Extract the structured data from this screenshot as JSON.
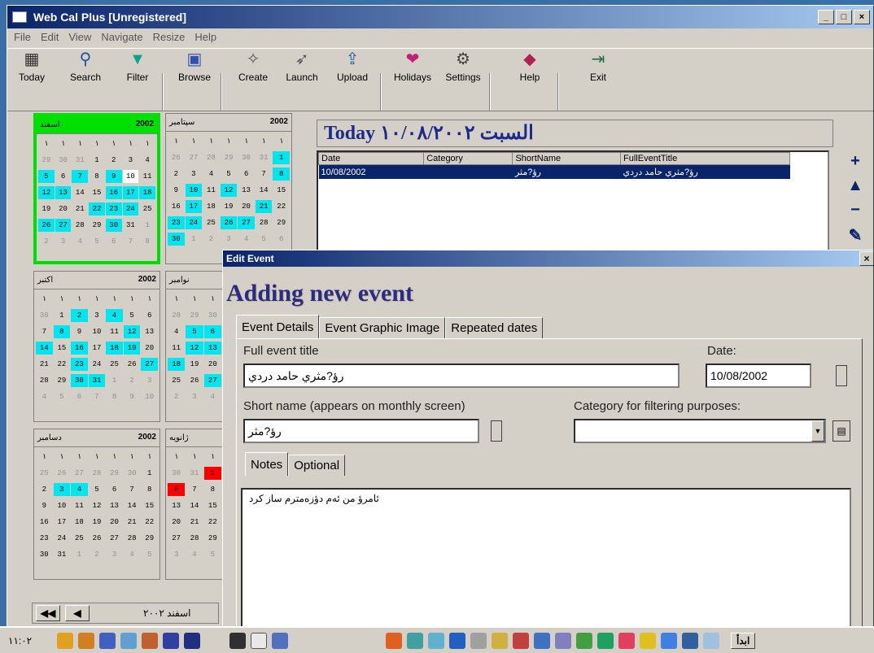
{
  "app": {
    "title": "Web Cal Plus [Unregistered]"
  },
  "window_controls": {
    "min": "_",
    "max": "□",
    "close": "×"
  },
  "menu": [
    "File",
    "Edit",
    "View",
    "Navigate",
    "Resize",
    "Help"
  ],
  "toolbar": {
    "today": "Today",
    "search": "Search",
    "filter": "Filter",
    "browse": "Browse",
    "create": "Create",
    "launch": "Launch",
    "upload": "Upload",
    "holidays": "Holidays",
    "settings": "Settings",
    "help": "Help",
    "exit": "Exit"
  },
  "calendars": [
    {
      "month": "اسفند",
      "year": "2002",
      "days": [
        {
          "t": "١"
        },
        {
          "t": "١"
        },
        {
          "t": "١"
        },
        {
          "t": "١"
        },
        {
          "t": "١"
        },
        {
          "t": "١"
        },
        {
          "t": "١"
        },
        {
          "t": "29",
          "s": "g"
        },
        {
          "t": "30",
          "s": "g"
        },
        {
          "t": "31",
          "s": "g"
        },
        {
          "t": "1"
        },
        {
          "t": "2"
        },
        {
          "t": "3"
        },
        {
          "t": "4"
        },
        {
          "t": "5",
          "s": "c"
        },
        {
          "t": "6"
        },
        {
          "t": "7",
          "s": "c"
        },
        {
          "t": "8"
        },
        {
          "t": "9",
          "s": "c"
        },
        {
          "t": "10",
          "s": "w"
        },
        {
          "t": "11"
        },
        {
          "t": "12",
          "s": "c"
        },
        {
          "t": "13",
          "s": "c"
        },
        {
          "t": "14"
        },
        {
          "t": "15"
        },
        {
          "t": "16",
          "s": "c"
        },
        {
          "t": "17",
          "s": "c"
        },
        {
          "t": "18",
          "s": "c"
        },
        {
          "t": "19"
        },
        {
          "t": "20"
        },
        {
          "t": "21"
        },
        {
          "t": "22",
          "s": "c"
        },
        {
          "t": "23",
          "s": "c"
        },
        {
          "t": "24",
          "s": "c"
        },
        {
          "t": "25"
        },
        {
          "t": "26",
          "s": "c"
        },
        {
          "t": "27",
          "s": "c"
        },
        {
          "t": "28"
        },
        {
          "t": "29"
        },
        {
          "t": "30",
          "s": "c"
        },
        {
          "t": "31"
        },
        {
          "t": "1",
          "s": "g"
        },
        {
          "t": "2",
          "s": "g"
        },
        {
          "t": "3",
          "s": "g"
        },
        {
          "t": "4",
          "s": "g"
        },
        {
          "t": "5",
          "s": "g"
        },
        {
          "t": "6",
          "s": "g"
        },
        {
          "t": "7",
          "s": "g"
        },
        {
          "t": "8",
          "s": "g"
        }
      ]
    },
    {
      "month": "سپتامبر",
      "year": "2002",
      "days": [
        {
          "t": "١"
        },
        {
          "t": "١"
        },
        {
          "t": "١"
        },
        {
          "t": "١"
        },
        {
          "t": "١"
        },
        {
          "t": "١"
        },
        {
          "t": "١"
        },
        {
          "t": "26",
          "s": "g"
        },
        {
          "t": "27",
          "s": "g"
        },
        {
          "t": "28",
          "s": "g"
        },
        {
          "t": "29",
          "s": "g"
        },
        {
          "t": "30",
          "s": "g"
        },
        {
          "t": "31",
          "s": "g"
        },
        {
          "t": "1",
          "s": "c"
        },
        {
          "t": "2"
        },
        {
          "t": "3"
        },
        {
          "t": "4"
        },
        {
          "t": "5"
        },
        {
          "t": "6"
        },
        {
          "t": "7"
        },
        {
          "t": "8",
          "s": "c"
        },
        {
          "t": "9"
        },
        {
          "t": "10",
          "s": "c"
        },
        {
          "t": "11"
        },
        {
          "t": "12",
          "s": "c"
        },
        {
          "t": "13"
        },
        {
          "t": "14"
        },
        {
          "t": "15"
        },
        {
          "t": "16"
        },
        {
          "t": "17",
          "s": "c"
        },
        {
          "t": "18"
        },
        {
          "t": "19"
        },
        {
          "t": "20"
        },
        {
          "t": "21",
          "s": "c"
        },
        {
          "t": "22"
        },
        {
          "t": "23",
          "s": "c"
        },
        {
          "t": "24",
          "s": "c"
        },
        {
          "t": "25"
        },
        {
          "t": "26",
          "s": "c"
        },
        {
          "t": "27",
          "s": "c"
        },
        {
          "t": "28"
        },
        {
          "t": "29"
        },
        {
          "t": "30",
          "s": "c"
        },
        {
          "t": "1",
          "s": "g"
        },
        {
          "t": "2",
          "s": "g"
        },
        {
          "t": "3",
          "s": "g"
        },
        {
          "t": "4",
          "s": "g"
        },
        {
          "t": "5",
          "s": "g"
        },
        {
          "t": "6",
          "s": "g"
        }
      ]
    },
    {
      "month": "اکتبر",
      "year": "2002",
      "days": [
        {
          "t": "١"
        },
        {
          "t": "١"
        },
        {
          "t": "١"
        },
        {
          "t": "١"
        },
        {
          "t": "١"
        },
        {
          "t": "١"
        },
        {
          "t": "١"
        },
        {
          "t": "30",
          "s": "g"
        },
        {
          "t": "1"
        },
        {
          "t": "2",
          "s": "c"
        },
        {
          "t": "3"
        },
        {
          "t": "4",
          "s": "c"
        },
        {
          "t": "5"
        },
        {
          "t": "6"
        },
        {
          "t": "7"
        },
        {
          "t": "8",
          "s": "c"
        },
        {
          "t": "9"
        },
        {
          "t": "10"
        },
        {
          "t": "11"
        },
        {
          "t": "12",
          "s": "c"
        },
        {
          "t": "13"
        },
        {
          "t": "14",
          "s": "c"
        },
        {
          "t": "15"
        },
        {
          "t": "16",
          "s": "c"
        },
        {
          "t": "17"
        },
        {
          "t": "18",
          "s": "c"
        },
        {
          "t": "19",
          "s": "c"
        },
        {
          "t": "20"
        },
        {
          "t": "21"
        },
        {
          "t": "22"
        },
        {
          "t": "23",
          "s": "c"
        },
        {
          "t": "24"
        },
        {
          "t": "25"
        },
        {
          "t": "26"
        },
        {
          "t": "27",
          "s": "c"
        },
        {
          "t": "28"
        },
        {
          "t": "29"
        },
        {
          "t": "30",
          "s": "c"
        },
        {
          "t": "31",
          "s": "c"
        },
        {
          "t": "1",
          "s": "g"
        },
        {
          "t": "2",
          "s": "g"
        },
        {
          "t": "3",
          "s": "g"
        },
        {
          "t": "4",
          "s": "g"
        },
        {
          "t": "5",
          "s": "g"
        },
        {
          "t": "6",
          "s": "g"
        },
        {
          "t": "7",
          "s": "g"
        },
        {
          "t": "8",
          "s": "g"
        },
        {
          "t": "9",
          "s": "g"
        },
        {
          "t": "10",
          "s": "g"
        }
      ]
    },
    {
      "month": "نوامبر",
      "year": "",
      "days": [
        {
          "t": "١"
        },
        {
          "t": "١"
        },
        {
          "t": "١"
        },
        {
          "t": "28",
          "s": "g"
        },
        {
          "t": "29",
          "s": "g"
        },
        {
          "t": "30",
          "s": "g"
        },
        {
          "t": "4"
        },
        {
          "t": "5",
          "s": "c"
        },
        {
          "t": "6",
          "s": "c"
        },
        {
          "t": "11"
        },
        {
          "t": "12",
          "s": "c"
        },
        {
          "t": "13",
          "s": "c"
        },
        {
          "t": "18",
          "s": "c"
        },
        {
          "t": "19"
        },
        {
          "t": "20"
        },
        {
          "t": "25"
        },
        {
          "t": "26"
        },
        {
          "t": "27",
          "s": "c"
        },
        {
          "t": "2",
          "s": "g"
        },
        {
          "t": "3",
          "s": "g"
        },
        {
          "t": "4",
          "s": "g"
        }
      ]
    },
    {
      "month": "دسامبر",
      "year": "2002",
      "days": [
        {
          "t": "١"
        },
        {
          "t": "١"
        },
        {
          "t": "١"
        },
        {
          "t": "١"
        },
        {
          "t": "١"
        },
        {
          "t": "١"
        },
        {
          "t": "١"
        },
        {
          "t": "25",
          "s": "g"
        },
        {
          "t": "26",
          "s": "g"
        },
        {
          "t": "27",
          "s": "g"
        },
        {
          "t": "28",
          "s": "g"
        },
        {
          "t": "29",
          "s": "g"
        },
        {
          "t": "30",
          "s": "g"
        },
        {
          "t": "1"
        },
        {
          "t": "2"
        },
        {
          "t": "3",
          "s": "c"
        },
        {
          "t": "4",
          "s": "c"
        },
        {
          "t": "5"
        },
        {
          "t": "6"
        },
        {
          "t": "7"
        },
        {
          "t": "8"
        },
        {
          "t": "9"
        },
        {
          "t": "10"
        },
        {
          "t": "11"
        },
        {
          "t": "12"
        },
        {
          "t": "13"
        },
        {
          "t": "14"
        },
        {
          "t": "15"
        },
        {
          "t": "16"
        },
        {
          "t": "17"
        },
        {
          "t": "18"
        },
        {
          "t": "19"
        },
        {
          "t": "20"
        },
        {
          "t": "21"
        },
        {
          "t": "22"
        },
        {
          "t": "23"
        },
        {
          "t": "24"
        },
        {
          "t": "25"
        },
        {
          "t": "26"
        },
        {
          "t": "27"
        },
        {
          "t": "28"
        },
        {
          "t": "29"
        },
        {
          "t": "30"
        },
        {
          "t": "31"
        },
        {
          "t": "1",
          "s": "g"
        },
        {
          "t": "2",
          "s": "g"
        },
        {
          "t": "3",
          "s": "g"
        },
        {
          "t": "4",
          "s": "g"
        },
        {
          "t": "5",
          "s": "g"
        }
      ]
    },
    {
      "month": "ژانویه",
      "year": "",
      "days": [
        {
          "t": "١"
        },
        {
          "t": "١"
        },
        {
          "t": "١"
        },
        {
          "t": "30",
          "s": "g"
        },
        {
          "t": "31",
          "s": "g"
        },
        {
          "t": "1",
          "s": "r"
        },
        {
          "t": "6",
          "s": "r"
        },
        {
          "t": "7"
        },
        {
          "t": "8"
        },
        {
          "t": "13"
        },
        {
          "t": "14"
        },
        {
          "t": "15"
        },
        {
          "t": "20"
        },
        {
          "t": "21"
        },
        {
          "t": "22"
        },
        {
          "t": "27"
        },
        {
          "t": "28"
        },
        {
          "t": "29"
        },
        {
          "t": "3",
          "s": "g"
        },
        {
          "t": "4",
          "s": "g"
        },
        {
          "t": "5",
          "s": "g"
        }
      ]
    }
  ],
  "nav": {
    "first": "◀◀",
    "prev": "◀",
    "label": "اسفند ۲۰۰۲"
  },
  "today_bar": {
    "text": "Today  السبت ١٠/٠٨/٢٠٠٢"
  },
  "events_table": {
    "columns": [
      "Date",
      "Category",
      "ShortName",
      "FullEventTitle"
    ],
    "rows": [
      [
        "10/08/2002",
        "",
        "رؤ?مثر",
        "رؤ?مثري حامد دردي"
      ]
    ]
  },
  "side_buttons": [
    "+",
    "▲",
    "−",
    "✎"
  ],
  "dialog": {
    "title": "Edit Event",
    "close": "×",
    "heading": "Adding new event",
    "tabs": [
      "Event Details",
      "Event Graphic Image",
      "Repeated dates"
    ],
    "full_title_label": "Full event title",
    "full_title_value": "رؤ?مثري حامد دردي",
    "date_label": "Date:",
    "date_value": "10/08/2002",
    "short_label": "Short name (appears on monthly screen)",
    "short_value": "رؤ?مثر",
    "category_label": "Category for filtering purposes:",
    "category_value": "",
    "subtabs": [
      "Notes",
      "Optional"
    ],
    "notes_value": "ئامرؤ من ئەم دؤزەمترم ساز كرد"
  },
  "taskbar": {
    "clock": "١١:٠٢",
    "start": "ابدأ"
  }
}
